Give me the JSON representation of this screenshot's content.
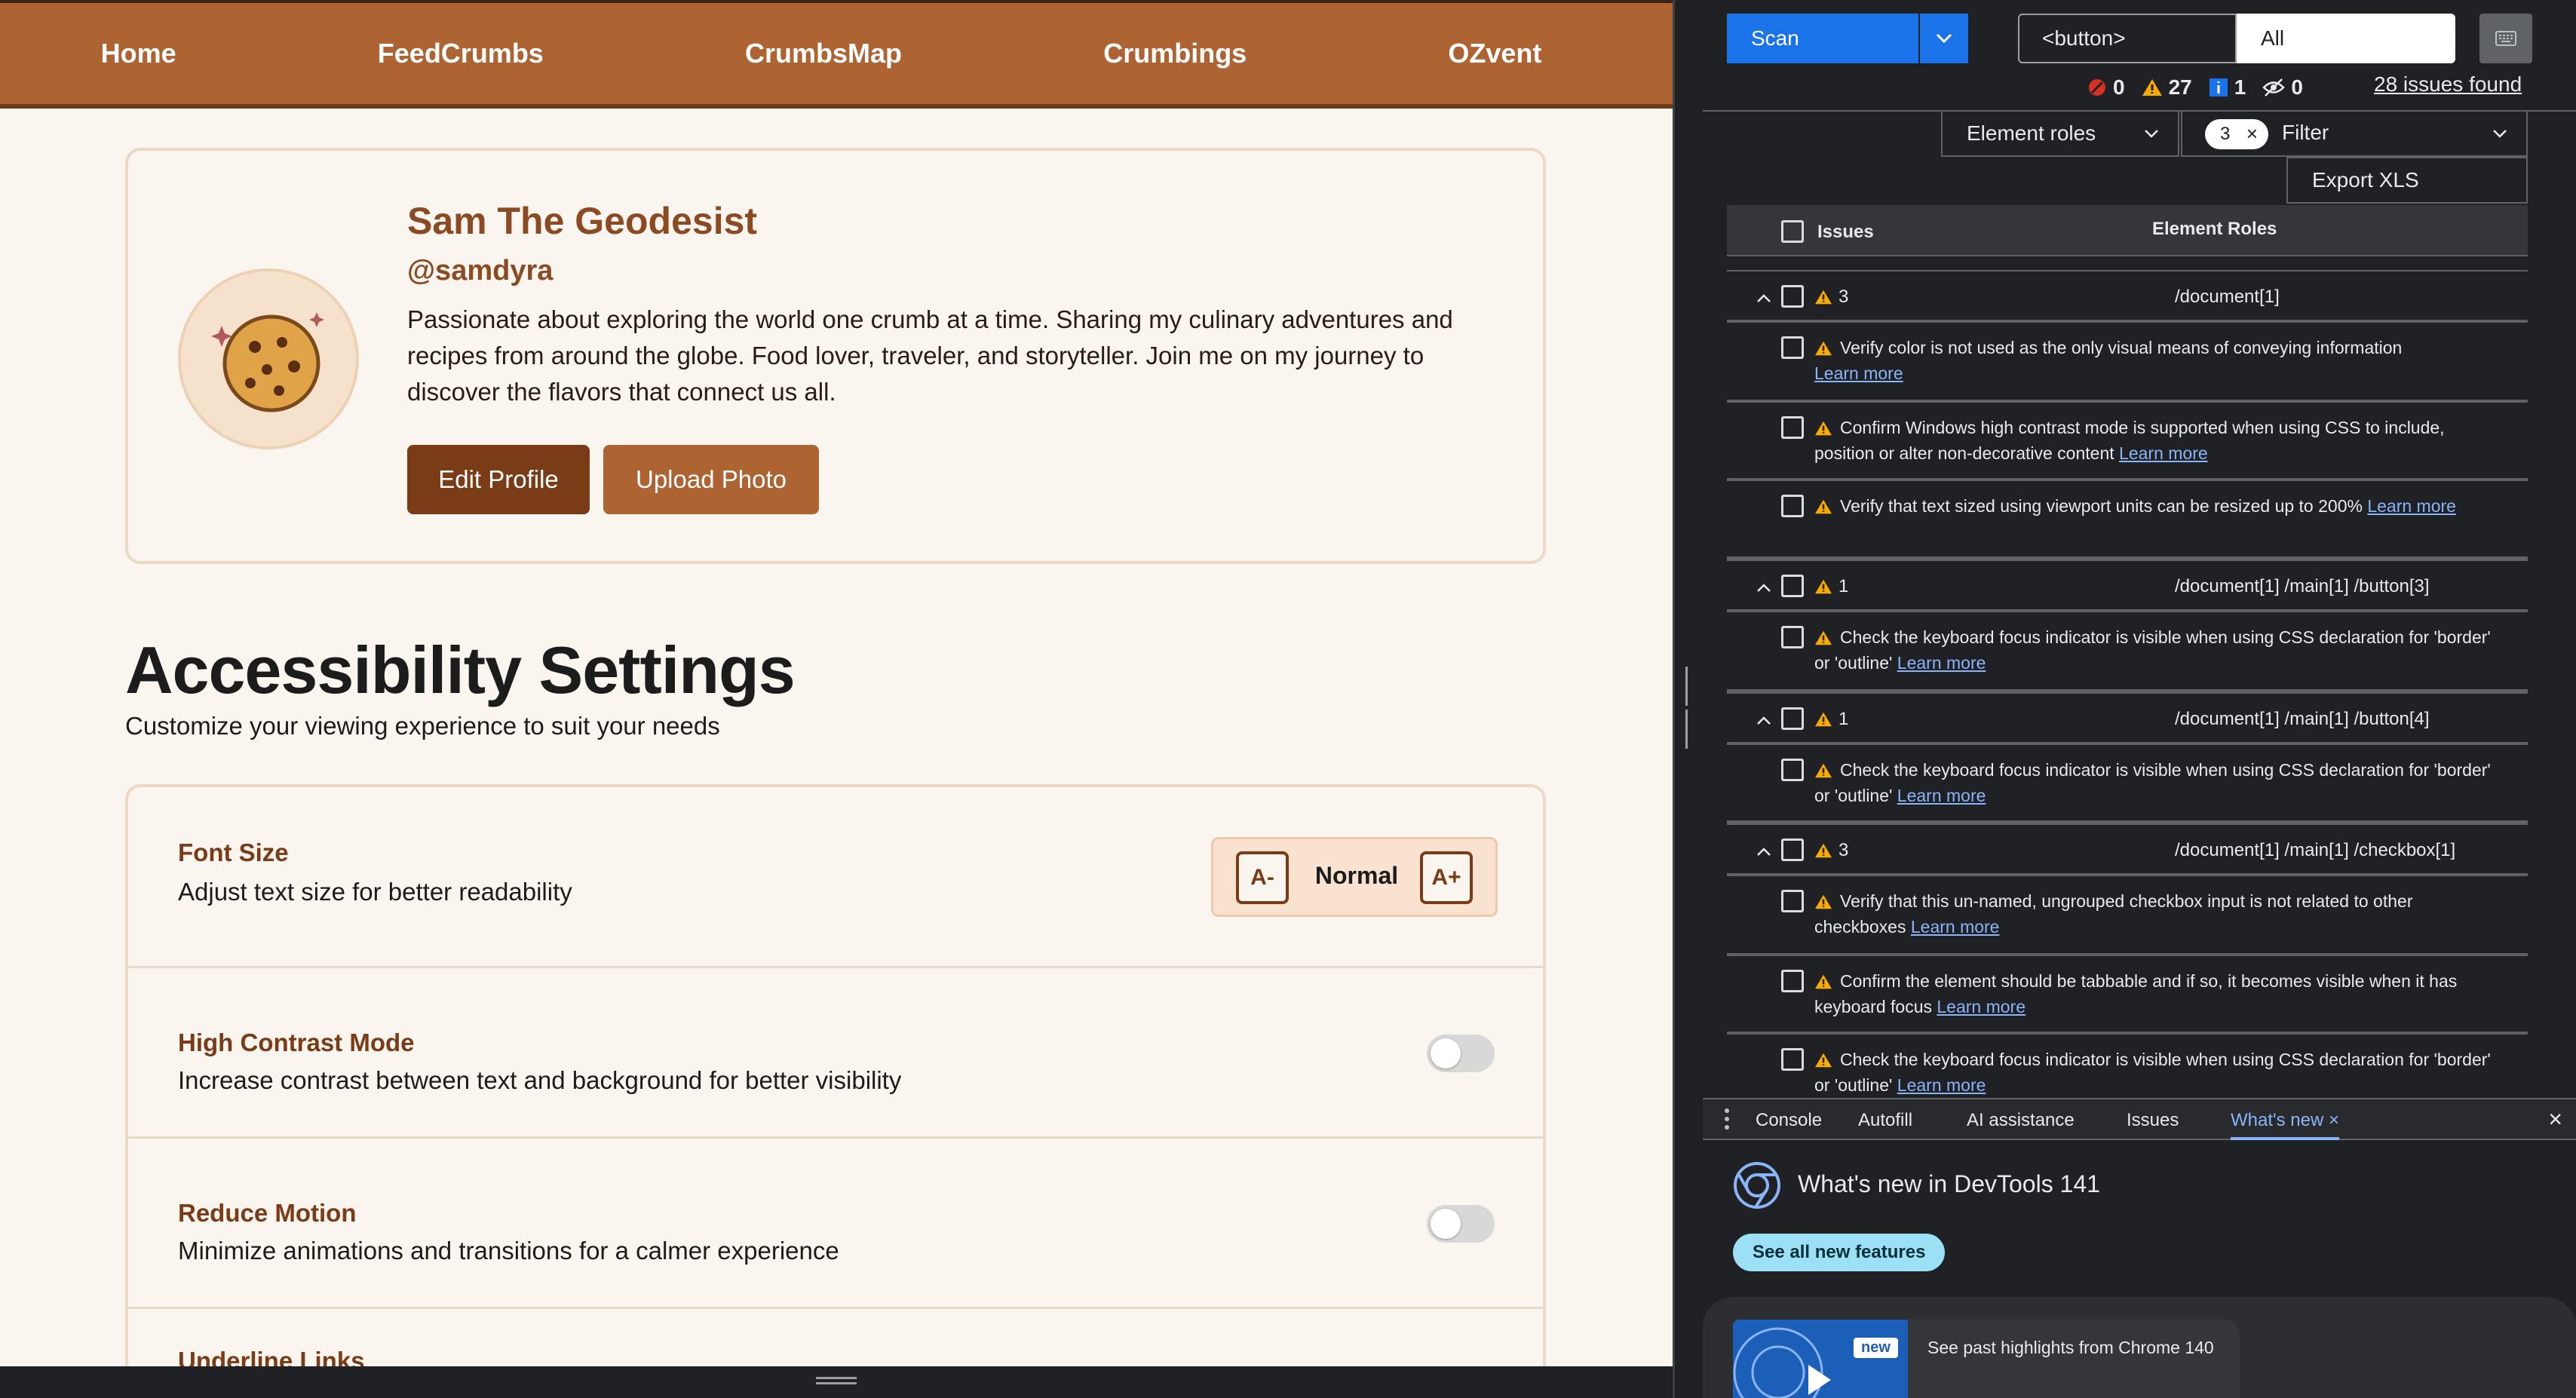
{
  "nav": {
    "items": [
      "Home",
      "FeedCrumbs",
      "CrumbsMap",
      "Crumbings",
      "OZvent"
    ]
  },
  "profile": {
    "name": "Sam The Geodesist",
    "handle": "@samdyra",
    "bio": "Passionate about exploring the world one crumb at a time. Sharing my culinary adventures and recipes from around the globe. Food lover, traveler, and storyteller. Join me on my journey to discover the flavors that connect us all.",
    "edit_label": "Edit Profile",
    "upload_label": "Upload Photo",
    "avatar_icon": "cookie-icon"
  },
  "accessibility": {
    "title": "Accessibility Settings",
    "subtitle": "Customize your viewing experience to suit your needs",
    "font_size": {
      "title": "Font Size",
      "desc": "Adjust text size for better readability",
      "dec": "A-",
      "level": "Normal",
      "inc": "A+"
    },
    "high_contrast": {
      "title": "High Contrast Mode",
      "desc": "Increase contrast between text and background for better visibility",
      "on": false
    },
    "reduce_motion": {
      "title": "Reduce Motion",
      "desc": "Minimize animations and transitions for a calmer experience",
      "on": false
    },
    "underline_links": {
      "title": "Underline Links"
    }
  },
  "devtools": {
    "scan_label": "Scan",
    "element_input": "<button>",
    "all_select": "All",
    "counts": {
      "errors": "0",
      "warnings": "27",
      "info": "1",
      "hidden": "0"
    },
    "issues_found": "28 issues found",
    "roles_select": "Element roles",
    "filter_chip": "3",
    "filter_label": "Filter",
    "export_label": "Export XLS",
    "table_headers": {
      "issues": "Issues",
      "roles": "Element Roles"
    },
    "learn_more": "Learn more",
    "groups": [
      {
        "count": "3",
        "path": "/document[1]",
        "issues": [
          "Verify color is not used as the only visual means of conveying information",
          "Confirm Windows high contrast mode is supported when using CSS to include, position or alter non-decorative content",
          "Verify that text sized using viewport units can be resized up to 200%"
        ]
      },
      {
        "count": "1",
        "path": "/document[1] /main[1] /button[3]",
        "issues": [
          "Check the keyboard focus indicator is visible when using CSS declaration for 'border' or 'outline'"
        ]
      },
      {
        "count": "1",
        "path": "/document[1] /main[1] /button[4]",
        "issues": [
          "Check the keyboard focus indicator is visible when using CSS declaration for 'border' or 'outline'"
        ]
      },
      {
        "count": "3",
        "path": "/document[1] /main[1] /checkbox[1]",
        "issues": [
          "Verify that this un-named, ungrouped checkbox input is not related to other checkboxes",
          "Confirm the element should be tabbable and if so, it becomes visible when it has keyboard focus",
          "Check the keyboard focus indicator is visible when using CSS declaration for 'border' or 'outline'"
        ]
      }
    ],
    "drawer_tabs": [
      "Console",
      "Autofill",
      "AI assistance",
      "Issues",
      "What's new"
    ],
    "whats_new_title": "What's new in DevTools 141",
    "whats_new_button": "See all new features",
    "new_badge": "new",
    "past_highlights": "See past highlights from Chrome 140",
    "colors": {
      "accent": "#1a73e8",
      "warning": "#f9ab00",
      "link": "#8ab4f8",
      "brand": "#ad6332"
    }
  }
}
